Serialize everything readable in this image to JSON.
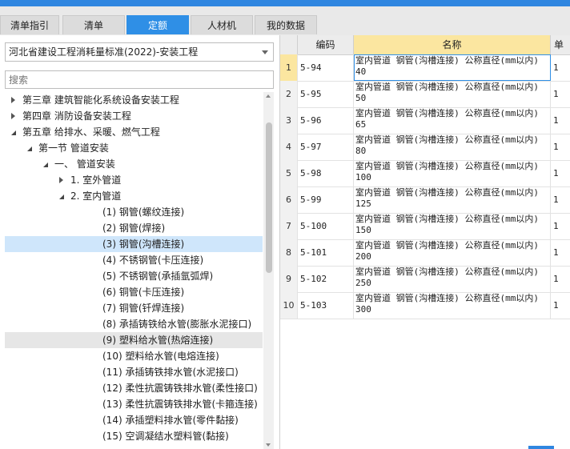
{
  "tabs": [
    {
      "label": "清单指引",
      "active": false
    },
    {
      "label": "清单",
      "active": false
    },
    {
      "label": "定额",
      "active": true
    },
    {
      "label": "人材机",
      "active": false
    },
    {
      "label": "我的数据",
      "active": false
    }
  ],
  "standard_select": {
    "value": "河北省建设工程消耗量标准(2022)-安装工程"
  },
  "search": {
    "placeholder": "搜索"
  },
  "tree": [
    {
      "label": "第三章 建筑智能化系统设备安装工程",
      "state": "closed",
      "level": 1
    },
    {
      "label": "第四章 消防设备安装工程",
      "state": "closed",
      "level": 1
    },
    {
      "label": "第五章 给排水、采暖、燃气工程",
      "state": "open",
      "level": 1
    },
    {
      "label": "第一节 管道安装",
      "state": "open",
      "level": 2
    },
    {
      "label": "一、 管道安装",
      "state": "open",
      "level": 3
    },
    {
      "label": "1. 室外管道",
      "state": "closed",
      "level": 4
    },
    {
      "label": "2. 室内管道",
      "state": "open",
      "level": 4
    },
    {
      "label": "(1) 钢管(螺纹连接)",
      "state": "leaf",
      "level": 5
    },
    {
      "label": "(2) 钢管(焊接)",
      "state": "leaf",
      "level": 5
    },
    {
      "label": "(3) 钢管(沟槽连接)",
      "state": "leaf",
      "level": 5,
      "selected": true
    },
    {
      "label": "(4) 不锈钢管(卡压连接)",
      "state": "leaf",
      "level": 5
    },
    {
      "label": "(5) 不锈钢管(承插氩弧焊)",
      "state": "leaf",
      "level": 5
    },
    {
      "label": "(6) 铜管(卡压连接)",
      "state": "leaf",
      "level": 5
    },
    {
      "label": "(7) 铜管(钎焊连接)",
      "state": "leaf",
      "level": 5
    },
    {
      "label": "(8) 承插铸铁给水管(膨胀水泥接口)",
      "state": "leaf",
      "level": 5
    },
    {
      "label": "(9) 塑料给水管(热熔连接)",
      "state": "leaf",
      "level": 5,
      "hover": true
    },
    {
      "label": "(10) 塑料给水管(电熔连接)",
      "state": "leaf",
      "level": 5
    },
    {
      "label": "(11) 承插铸铁排水管(水泥接口)",
      "state": "leaf",
      "level": 5
    },
    {
      "label": "(12) 柔性抗震铸铁排水管(柔性接口)",
      "state": "leaf",
      "level": 5
    },
    {
      "label": "(13) 柔性抗震铸铁排水管(卡箍连接)",
      "state": "leaf",
      "level": 5
    },
    {
      "label": "(14) 承插塑料排水管(零件黏接)",
      "state": "leaf",
      "level": 5
    },
    {
      "label": "(15) 空调凝结水塑料管(黏接)",
      "state": "leaf",
      "level": 5
    }
  ],
  "grid": {
    "headers": {
      "code": "编码",
      "name": "名称",
      "unit": "单"
    },
    "rows": [
      {
        "num": "1",
        "code": "5-94",
        "name": "室内管道 钢管(沟槽连接) 公称直径(mm以内) 40",
        "unit": "1"
      },
      {
        "num": "2",
        "code": "5-95",
        "name": "室内管道 钢管(沟槽连接) 公称直径(mm以内) 50",
        "unit": "1"
      },
      {
        "num": "3",
        "code": "5-96",
        "name": "室内管道 钢管(沟槽连接) 公称直径(mm以内) 65",
        "unit": "1"
      },
      {
        "num": "4",
        "code": "5-97",
        "name": "室内管道 钢管(沟槽连接) 公称直径(mm以内) 80",
        "unit": "1"
      },
      {
        "num": "5",
        "code": "5-98",
        "name": "室内管道 钢管(沟槽连接) 公称直径(mm以内) 100",
        "unit": "1"
      },
      {
        "num": "6",
        "code": "5-99",
        "name": "室内管道 钢管(沟槽连接) 公称直径(mm以内) 125",
        "unit": "1"
      },
      {
        "num": "7",
        "code": "5-100",
        "name": "室内管道 钢管(沟槽连接) 公称直径(mm以内) 150",
        "unit": "1"
      },
      {
        "num": "8",
        "code": "5-101",
        "name": "室内管道 钢管(沟槽连接) 公称直径(mm以内) 200",
        "unit": "1"
      },
      {
        "num": "9",
        "code": "5-102",
        "name": "室内管道 钢管(沟槽连接) 公称直径(mm以内) 250",
        "unit": "1"
      },
      {
        "num": "10",
        "code": "5-103",
        "name": "室内管道 钢管(沟槽连接) 公称直径(mm以内) 300",
        "unit": "1"
      }
    ]
  }
}
